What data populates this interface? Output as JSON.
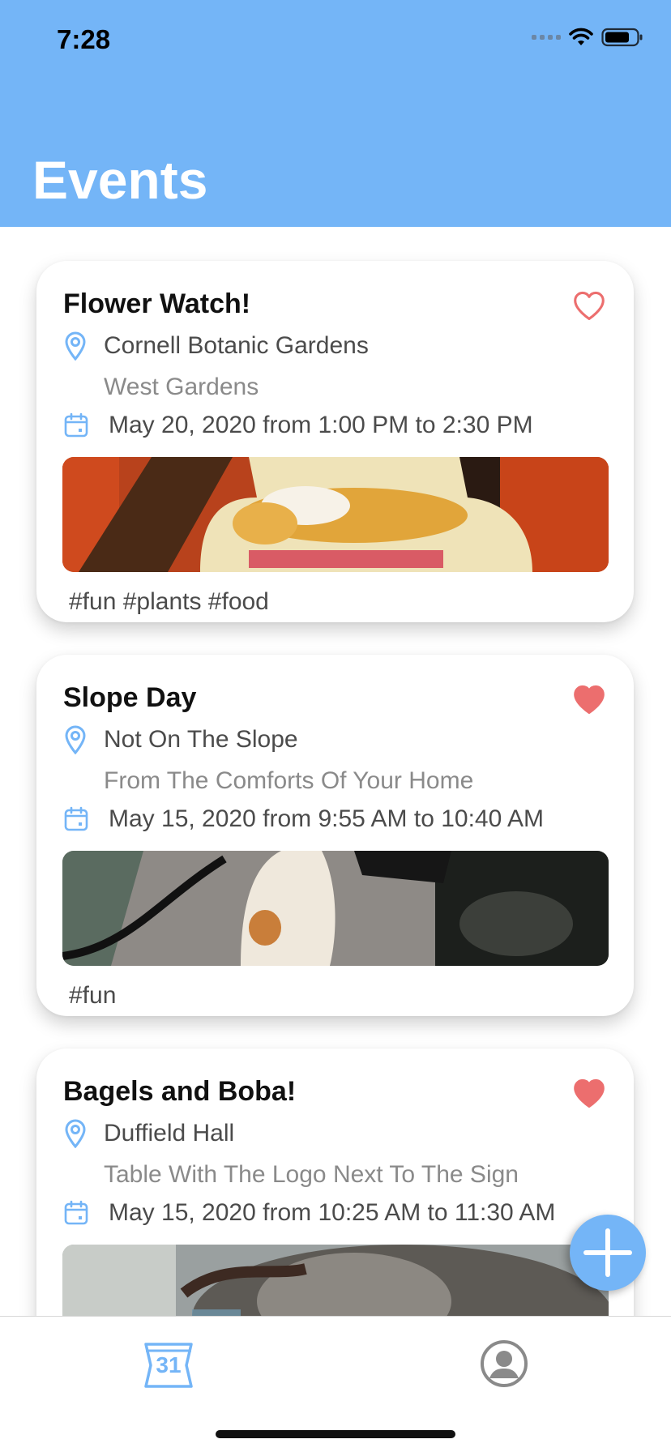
{
  "status": {
    "time": "7:28"
  },
  "header": {
    "title": "Events"
  },
  "events": [
    {
      "title": "Flower Watch!",
      "favorited": false,
      "location": "Cornell Botanic Gardens",
      "sublocation": "West Gardens",
      "datetime": "May 20, 2020 from 1:00 PM to 2:30 PM",
      "tags": "#fun #plants #food"
    },
    {
      "title": "Slope Day",
      "favorited": true,
      "location": "Not On The Slope",
      "sublocation": "From The Comforts Of Your Home",
      "datetime": "May 15, 2020 from 9:55 AM to 10:40 AM",
      "tags": "#fun"
    },
    {
      "title": "Bagels and Boba!",
      "favorited": true,
      "location": "Duffield Hall",
      "sublocation": "Table With The Logo Next To The Sign",
      "datetime": "May 15, 2020 from 10:25 AM to 11:30 AM",
      "tags": ""
    }
  ],
  "tabbar": {
    "calendar_day": "31",
    "calendar_icon": "calendar-icon",
    "profile_icon": "profile-icon"
  },
  "colors": {
    "accent": "#74b5f7",
    "heart": "#ec6e6e",
    "text_primary": "#111111",
    "text_secondary": "#4b4b4b",
    "text_muted": "#8a8a8a"
  }
}
